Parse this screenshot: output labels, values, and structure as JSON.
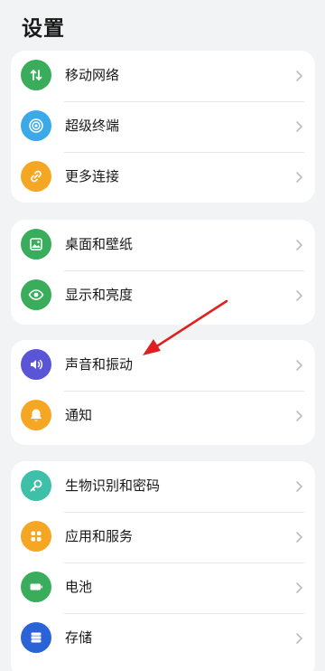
{
  "header": {
    "title": "设置"
  },
  "groups": [
    {
      "items": [
        {
          "label": "移动网络",
          "icon": "mobile-network-icon",
          "color": "#3aad5d"
        },
        {
          "label": "超级终端",
          "icon": "super-device-icon",
          "color": "#3ba9e8"
        },
        {
          "label": "更多连接",
          "icon": "link-icon",
          "color": "#f5a623"
        }
      ]
    },
    {
      "items": [
        {
          "label": "桌面和壁纸",
          "icon": "wallpaper-icon",
          "color": "#3aad5d"
        },
        {
          "label": "显示和亮度",
          "icon": "eye-icon",
          "color": "#3aad5d"
        }
      ]
    },
    {
      "items": [
        {
          "label": "声音和振动",
          "icon": "volume-icon",
          "color": "#5a55d6"
        },
        {
          "label": "通知",
          "icon": "bell-icon",
          "color": "#f5a623"
        }
      ]
    },
    {
      "items": [
        {
          "label": "生物识别和密码",
          "icon": "key-icon",
          "color": "#3dbfa8"
        },
        {
          "label": "应用和服务",
          "icon": "apps-icon",
          "color": "#f5a623"
        },
        {
          "label": "电池",
          "icon": "battery-icon",
          "color": "#3aad5d"
        },
        {
          "label": "存储",
          "icon": "storage-icon",
          "color": "#2a63d6"
        }
      ]
    }
  ],
  "annotation": {
    "color": "#e02020",
    "points_to": "声音和振动"
  }
}
